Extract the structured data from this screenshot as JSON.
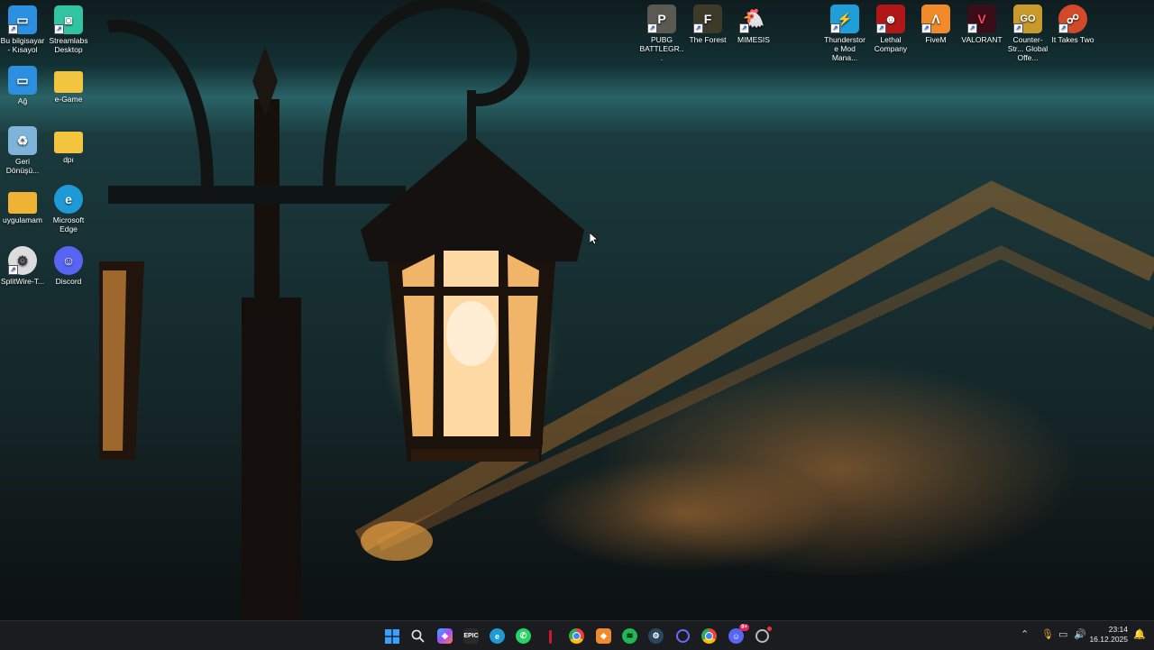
{
  "desktop": {
    "left_icons": [
      {
        "name": "bu-bilgisayar-icon",
        "label": "Bu bilgisayar - Kısayol",
        "color": "#2d8fe0",
        "glyph": "▭"
      },
      {
        "name": "streamlabs-icon",
        "label": "Streamlabs Desktop",
        "color": "#31c3a2",
        "glyph": "◙"
      },
      {
        "name": "ag-icon",
        "label": "Ağ",
        "color": "#2d8fe0",
        "glyph": "▭"
      },
      {
        "name": "e-game-folder-icon",
        "label": "e-Game",
        "color": "#f3c43d",
        "glyph": ""
      },
      {
        "name": "geri-donusum-icon",
        "label": "Geri Dönüşü...",
        "color": "#7fb3d9",
        "glyph": "♻"
      },
      {
        "name": "dpi-folder-icon",
        "label": "dpı",
        "color": "#f3c43d",
        "glyph": ""
      },
      {
        "name": "uygulamam-folder-icon",
        "label": "uygulamam",
        "color": "#f0b233",
        "glyph": ""
      },
      {
        "name": "microsoft-edge-icon",
        "label": "Microsoft Edge",
        "color": "#1e9bd7",
        "glyph": "e"
      },
      {
        "name": "splitwire-icon",
        "label": "SplitWire-T...",
        "color": "#dcdcdc",
        "glyph": "⚙"
      },
      {
        "name": "discord-icon",
        "label": "Discord",
        "color": "#5865f2",
        "glyph": "☺"
      }
    ],
    "top_icons": [
      {
        "name": "pubg-icon",
        "label": "PUBG BATTLEGR...",
        "color": "#5a5a52",
        "glyph": "P"
      },
      {
        "name": "the-forest-icon",
        "label": "The Forest",
        "color": "#3d3a2a",
        "glyph": "F"
      },
      {
        "name": "mimesis-icon",
        "label": "MIMESIS",
        "color": "#c0392b",
        "glyph": "M"
      },
      {
        "name": "thunderstore-icon",
        "label": "Thunderstore Mod Mana...",
        "color": "#1f9ed8",
        "glyph": "⚡"
      },
      {
        "name": "lethal-company-icon",
        "label": "Lethal Company",
        "color": "#b01818",
        "glyph": "☻"
      },
      {
        "name": "fivem-icon",
        "label": "FiveM",
        "color": "#f08a2a",
        "glyph": "Λ"
      },
      {
        "name": "valorant-icon",
        "label": "VALORANT",
        "color": "#3a0d18",
        "glyph": "V"
      },
      {
        "name": "counter-strike-icon",
        "label": "Counter-Str... Global Offe...",
        "color": "#c89a2c",
        "glyph": "GO"
      },
      {
        "name": "it-takes-two-icon",
        "label": "It Takes Two",
        "color": "#d24a2a",
        "glyph": "☍"
      }
    ]
  },
  "taskbar": {
    "apps": [
      {
        "name": "start-button-icon",
        "glyph": "⊞",
        "color": "#2f8bff"
      },
      {
        "name": "search-icon",
        "glyph": "⚲",
        "color": "transparent"
      },
      {
        "name": "copilot-icon",
        "glyph": "◈",
        "color": "#7a5cf0"
      },
      {
        "name": "epic-games-icon",
        "glyph": "E",
        "color": "#2a2a2a"
      },
      {
        "name": "edge-taskbar-icon",
        "glyph": "e",
        "color": "#1e9bd7"
      },
      {
        "name": "whatsapp-icon",
        "glyph": "✆",
        "color": "#25d366"
      },
      {
        "name": "red-app-icon",
        "glyph": "▮",
        "color": "#c0182a"
      },
      {
        "name": "chrome-icon",
        "glyph": "◉",
        "color": "#e94235"
      },
      {
        "name": "orange-app-icon",
        "glyph": "◆",
        "color": "#f08a2a"
      },
      {
        "name": "spotify-icon",
        "glyph": "≋",
        "color": "#1db954"
      },
      {
        "name": "steam-icon",
        "glyph": "⚙",
        "color": "#2a475e"
      },
      {
        "name": "ring-app-icon",
        "glyph": "○",
        "color": "#3b3bb8"
      },
      {
        "name": "chrome-2-icon",
        "glyph": "◉",
        "color": "#e94235"
      },
      {
        "name": "discord-taskbar-icon",
        "glyph": "☺",
        "color": "#5865f2"
      },
      {
        "name": "streamlabs-taskbar-icon",
        "glyph": "◎",
        "color": "#555"
      }
    ],
    "discord_badge": "9+",
    "clock": {
      "time": "23:14",
      "date": "16.12.2025"
    }
  }
}
